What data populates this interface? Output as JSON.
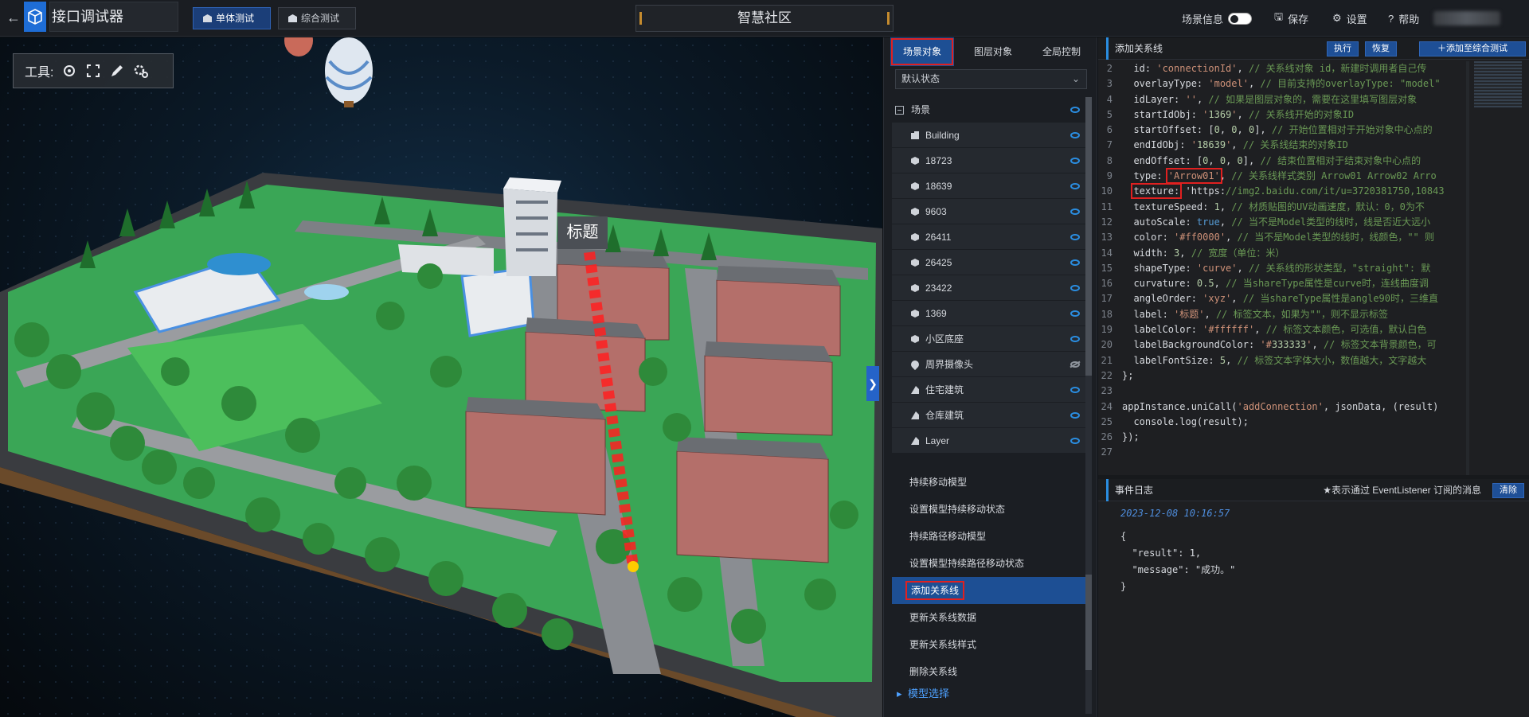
{
  "header": {
    "back_icon": "arrow-left-icon",
    "logo_icon": "cube-logo-icon",
    "app_title": "接口调试器",
    "mode_tabs": [
      {
        "label": "单体测试",
        "active": true
      },
      {
        "label": "综合测试",
        "active": false
      }
    ],
    "scene_title": "智慧社区",
    "scene_info_label": "场景信息",
    "save_label": "保存",
    "settings_label": "设置",
    "help_label": "帮助"
  },
  "viewport": {
    "toolbox_label": "工具:",
    "tools": [
      "locate-icon",
      "frame-icon",
      "pen-icon",
      "gears-icon"
    ],
    "label_tag": "标题",
    "collapse_glyph": "❯"
  },
  "tree_panel": {
    "tabs": [
      {
        "label": "场景对象",
        "active": true
      },
      {
        "label": "图层对象",
        "active": false
      },
      {
        "label": "全局控制",
        "active": false
      }
    ],
    "state_select": "默认状态",
    "root": "场景",
    "nodes": [
      {
        "label": "Building",
        "icon": "building-icon",
        "visible": true
      },
      {
        "label": "18723",
        "icon": "cube-icon",
        "visible": true
      },
      {
        "label": "18639",
        "icon": "cube-icon",
        "visible": true
      },
      {
        "label": "9603",
        "icon": "cube-icon",
        "visible": true
      },
      {
        "label": "26411",
        "icon": "cube-icon",
        "visible": true
      },
      {
        "label": "26425",
        "icon": "cube-icon",
        "visible": true
      },
      {
        "label": "23422",
        "icon": "cube-icon",
        "visible": true
      },
      {
        "label": "1369",
        "icon": "cube-icon",
        "visible": true
      },
      {
        "label": "小区底座",
        "icon": "cube-icon",
        "visible": true
      },
      {
        "label": "周界摄像头",
        "icon": "pin-icon",
        "visible": false
      },
      {
        "label": "住宅建筑",
        "icon": "layer-icon",
        "visible": true
      },
      {
        "label": "仓库建筑",
        "icon": "layer-icon",
        "visible": true
      },
      {
        "label": "Layer",
        "icon": "layer-icon",
        "visible": true
      }
    ],
    "api_items": [
      {
        "label": "持续移动模型",
        "selected": false
      },
      {
        "label": "设置模型持续移动状态",
        "selected": false
      },
      {
        "label": "持续路径移动模型",
        "selected": false
      },
      {
        "label": "设置模型持续路径移动状态",
        "selected": false
      },
      {
        "label": "添加关系线",
        "selected": true
      },
      {
        "label": "更新关系线数据",
        "selected": false
      },
      {
        "label": "更新关系线样式",
        "selected": false
      },
      {
        "label": "删除关系线",
        "selected": false
      }
    ],
    "api_group": "模型选择"
  },
  "code_panel": {
    "title": "添加关系线",
    "run_label": "执行",
    "reset_label": "恢复",
    "add_label": "添加至综合测试",
    "lines": [
      {
        "n": "2",
        "t": "  id: 'connectionId', // 关系线对象 id，新建时调用者自己传"
      },
      {
        "n": "3",
        "t": "  overlayType: 'model', // 目前支持的overlayType: \"model\""
      },
      {
        "n": "4",
        "t": "  idLayer: '', // 如果是图层对象的，需要在这里填写图层对象"
      },
      {
        "n": "5",
        "t": "  startIdObj: '1369', // 关系线开始的对象ID"
      },
      {
        "n": "6",
        "t": "  startOffset: [0, 0, 0], // 开始位置相对于开始对象中心点的"
      },
      {
        "n": "7",
        "t": "  endIdObj: '18639', // 关系线结束的对象ID"
      },
      {
        "n": "8",
        "t": "  endOffset: [0, 0, 0], // 结束位置相对于结束对象中心点的"
      },
      {
        "n": "9",
        "t": "  type: 'Arrow01', // 关系线样式类别 Arrow01 Arrow02 Arro"
      },
      {
        "n": "10",
        "t": "  texture: 'https://img2.baidu.com/it/u=3720381750,10843"
      },
      {
        "n": "11",
        "t": "  textureSpeed: 1, // 材质贴图的UV动画速度，默认：0，0为不"
      },
      {
        "n": "12",
        "t": "  autoScale: true, // 当不是Model类型的线时，线是否近大远小"
      },
      {
        "n": "13",
        "t": "  color: '#ff0000', // 当不是Model类型的线时，线颜色，\"\" 则"
      },
      {
        "n": "14",
        "t": "  width: 3, // 宽度（单位：米）"
      },
      {
        "n": "15",
        "t": "  shapeType: 'curve', // 关系线的形状类型，\"straight\": 默"
      },
      {
        "n": "16",
        "t": "  curvature: 0.5, // 当shareType属性是curve时，连线曲度调"
      },
      {
        "n": "17",
        "t": "  angleOrder: 'xyz', // 当shareType属性是angle90时，三维直"
      },
      {
        "n": "18",
        "t": "  label: '标题', // 标签文本，如果为\"\"，则不显示标签"
      },
      {
        "n": "19",
        "t": "  labelColor: '#ffffff', // 标签文本颜色，可选值，默认白色"
      },
      {
        "n": "20",
        "t": "  labelBackgroundColor: '#333333', // 标签文本背景颜色，可"
      },
      {
        "n": "21",
        "t": "  labelFontSize: 5, // 标签文本字体大小，数值越大，文字越大"
      },
      {
        "n": "22",
        "t": "};"
      },
      {
        "n": "23",
        "t": ""
      },
      {
        "n": "24",
        "t": "appInstance.uniCall('addConnection', jsonData, (result)"
      },
      {
        "n": "25",
        "t": "  console.log(result);"
      },
      {
        "n": "26",
        "t": "});"
      },
      {
        "n": "27",
        "t": ""
      }
    ]
  },
  "log_panel": {
    "title": "事件日志",
    "note": "★表示通过 EventListener 订阅的消息",
    "clear_label": "清除",
    "time": "2023-12-08 10:16:57",
    "body": "{\n  \"result\": 1,\n  \"message\": \"成功。\"\n}"
  }
}
